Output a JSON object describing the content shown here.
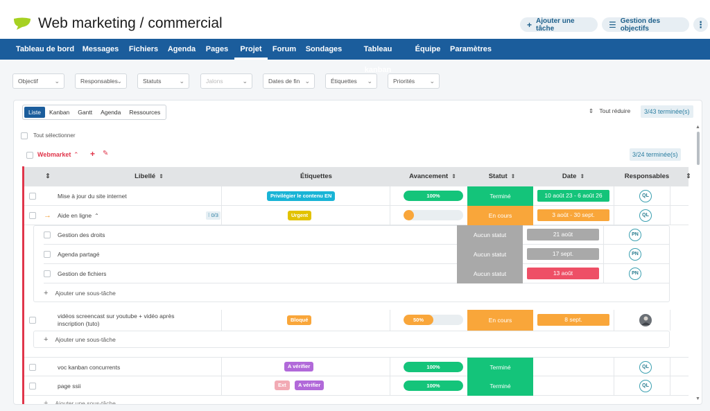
{
  "header": {
    "title": "Web marketing / commercial",
    "add_task": "Ajouter une tâche",
    "goals": "Gestion des objectifs",
    "more": "⋮",
    "brand_color": "#a6d122"
  },
  "nav": [
    "Tableau de bord",
    "Messages",
    "Fichiers",
    "Agenda",
    "Pages",
    "Projet",
    "Forum",
    "Sondages",
    "Tableau kanban",
    "Équipe",
    "Paramètres"
  ],
  "filters": [
    "Objectif",
    "Responsables",
    "Statuts",
    "Jalons",
    "Dates de fin",
    "Étiquettes",
    "Priorités"
  ],
  "view_tabs": [
    "Liste",
    "Kanban",
    "Gantt",
    "Agenda",
    "Ressources"
  ],
  "collapse_label": "Tout réduire",
  "done_total": "3/43 terminée(s)",
  "select_all": "Tout sélectionner",
  "group": {
    "name": "Webmarket",
    "done": "3/24 terminée(s)"
  },
  "columns": {
    "label": "Libellé",
    "tags": "Étiquettes",
    "progress": "Avancement",
    "status": "Statut",
    "date": "Date",
    "owners": "Responsables"
  },
  "rows": [
    {
      "label": "Mise à jour du site internet",
      "tags": [
        "Privilégier le contenu EN"
      ],
      "progress": 100,
      "progress_text": "100%",
      "status": "Terminé",
      "date": "10 août 23 - 6 août 26",
      "owner": "QL"
    },
    {
      "label": "Aide en ligne",
      "tags": [
        "Urgent"
      ],
      "progress": 0,
      "status": "En cours",
      "date": "3 août - 30 sept.",
      "owner": "QL",
      "subcount": "0/3"
    },
    {
      "label": "Gestion des droits",
      "status": "Aucun statut",
      "date": "21 août",
      "owner": "PN"
    },
    {
      "label": "Agenda partagé",
      "status": "Aucun statut",
      "date": "17 sept.",
      "owner": "PN"
    },
    {
      "label": "Gestion de fichiers",
      "status": "Aucun statut",
      "date": "13 août",
      "owner": "PN"
    },
    {
      "label": "vidéos screencast sur youtube + vidéo après inscription (tuto)",
      "tags": [
        "Bloqué"
      ],
      "progress": 50,
      "progress_text": "50%",
      "status": "En cours",
      "date": "8 sept."
    },
    {
      "label": "voc kanban concurrents",
      "tags": [
        "A vérifier"
      ],
      "progress": 100,
      "progress_text": "100%",
      "status": "Terminé",
      "owner": "QL"
    },
    {
      "label": "page ssii",
      "tags": [
        "Ext",
        "A vérifier"
      ],
      "progress": 100,
      "progress_text": "100%",
      "status": "Terminé",
      "owner": "QL"
    }
  ],
  "add_subtask": "Ajouter une sous-tâche",
  "colors": {
    "nav": "#1b5d9c",
    "green": "#14c47a",
    "orange": "#f9a63a",
    "grey": "#a9a9a9",
    "red": "#ee4f66",
    "cyan": "#19b4d6",
    "yellow": "#e2c200",
    "purple": "#b169d9",
    "pink": "#f2aab4"
  }
}
